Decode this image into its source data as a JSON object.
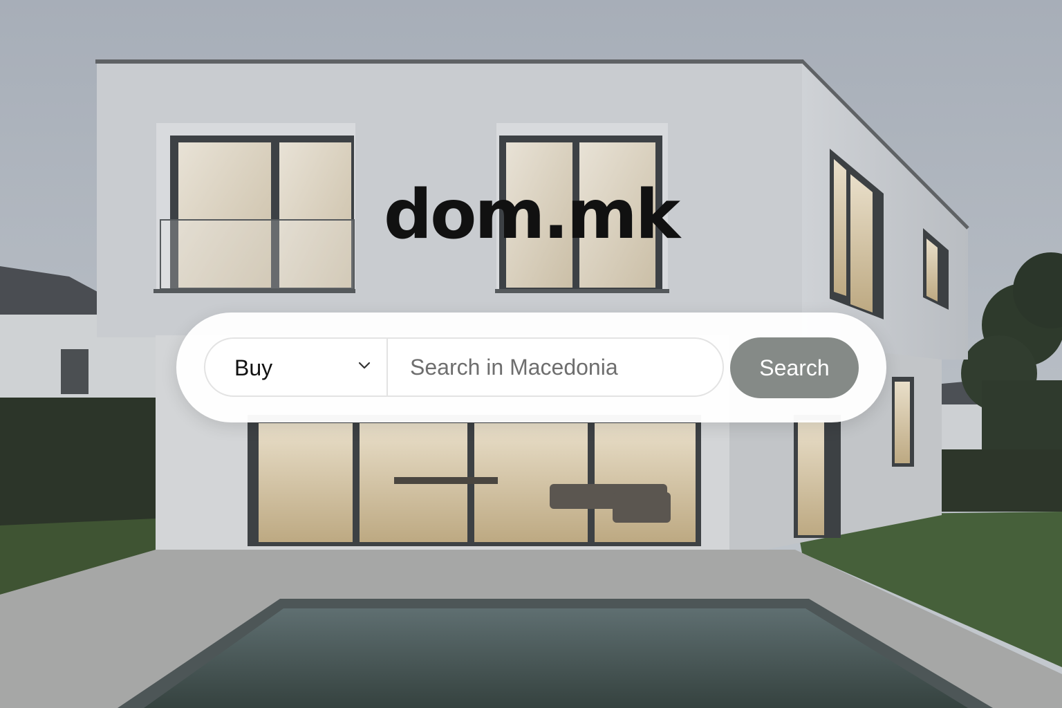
{
  "brand": {
    "name": "dom.mk"
  },
  "search": {
    "mode_selected": "Buy",
    "placeholder": "Search in Macedonia",
    "button_label": "Search"
  },
  "colors": {
    "search_button": "#858a87",
    "card": "#ffffff",
    "text": "#111111"
  },
  "icons": {
    "mode_select": "chevron-down-icon"
  }
}
